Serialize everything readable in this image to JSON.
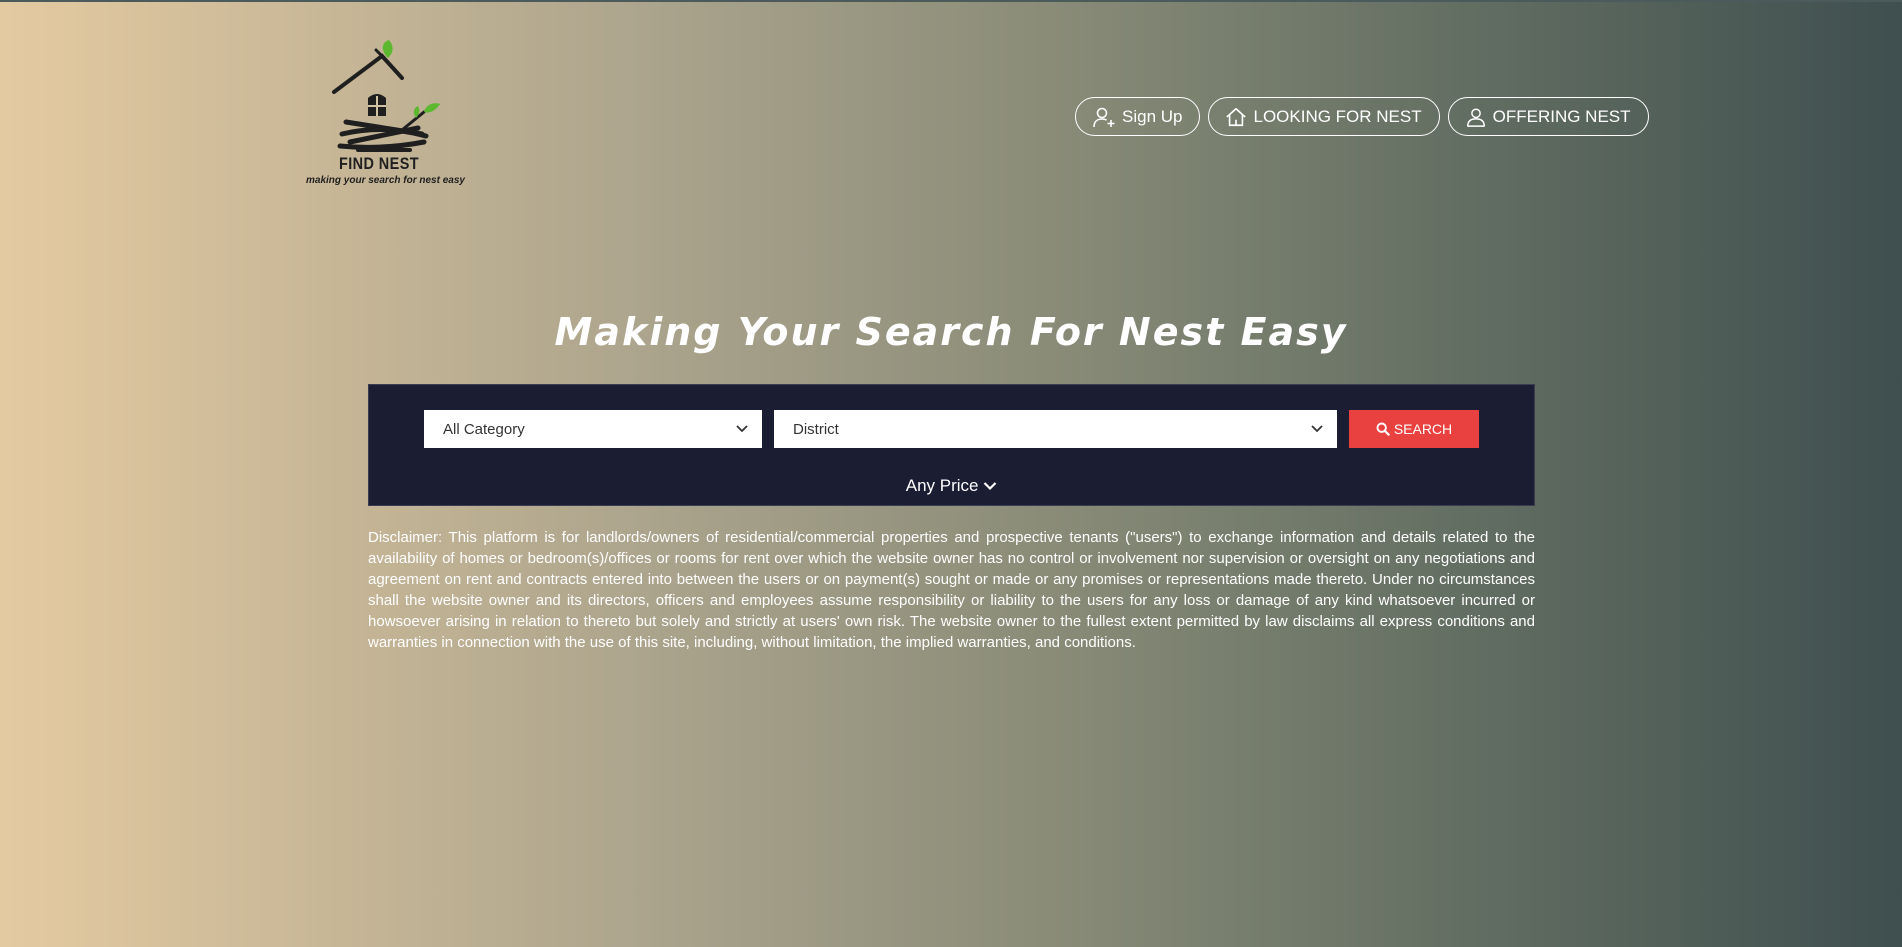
{
  "brand": {
    "name": "FIND NEST",
    "tagline": "making your search for nest easy"
  },
  "nav": {
    "signup_label": "Sign Up",
    "looking_label": "LOOKING FOR NEST",
    "offering_label": "OFFERING NEST"
  },
  "hero": {
    "title": "Making Your Search For Nest Easy"
  },
  "search": {
    "category_value": "All Category",
    "district_value": "District",
    "button_label": "SEARCH",
    "price_label": "Any Price"
  },
  "disclaimer": {
    "text": "Disclaimer: This platform is for landlords/owners of residential/commercial properties and prospective tenants (\"users\") to exchange information and details related to the availability of homes or bedroom(s)/offices or rooms for rent over which the website owner has no control or involvement nor supervision or oversight on any negotiations and agreement on rent and contracts entered into between the users or on payment(s) sought or made or any promises or representations made thereto. Under no circumstances shall the website owner and its directors, officers and employees assume responsibility or liability to the users for any loss or damage of any kind whatsoever incurred or howsoever arising in relation to thereto but solely and strictly at users' own risk. The website owner to the fullest extent permitted by law disclaims all express conditions and warranties in connection with the use of this site, including, without limitation, the implied warranties, and conditions."
  },
  "colors": {
    "panel": "#1b1d33",
    "search_button": "#e8413f",
    "leaf": "#5cb82e"
  },
  "icons": {
    "signup": "user-plus-icon",
    "looking": "home-icon",
    "offering": "user-icon",
    "search": "search-icon",
    "dropdown": "chevron-down-icon"
  }
}
